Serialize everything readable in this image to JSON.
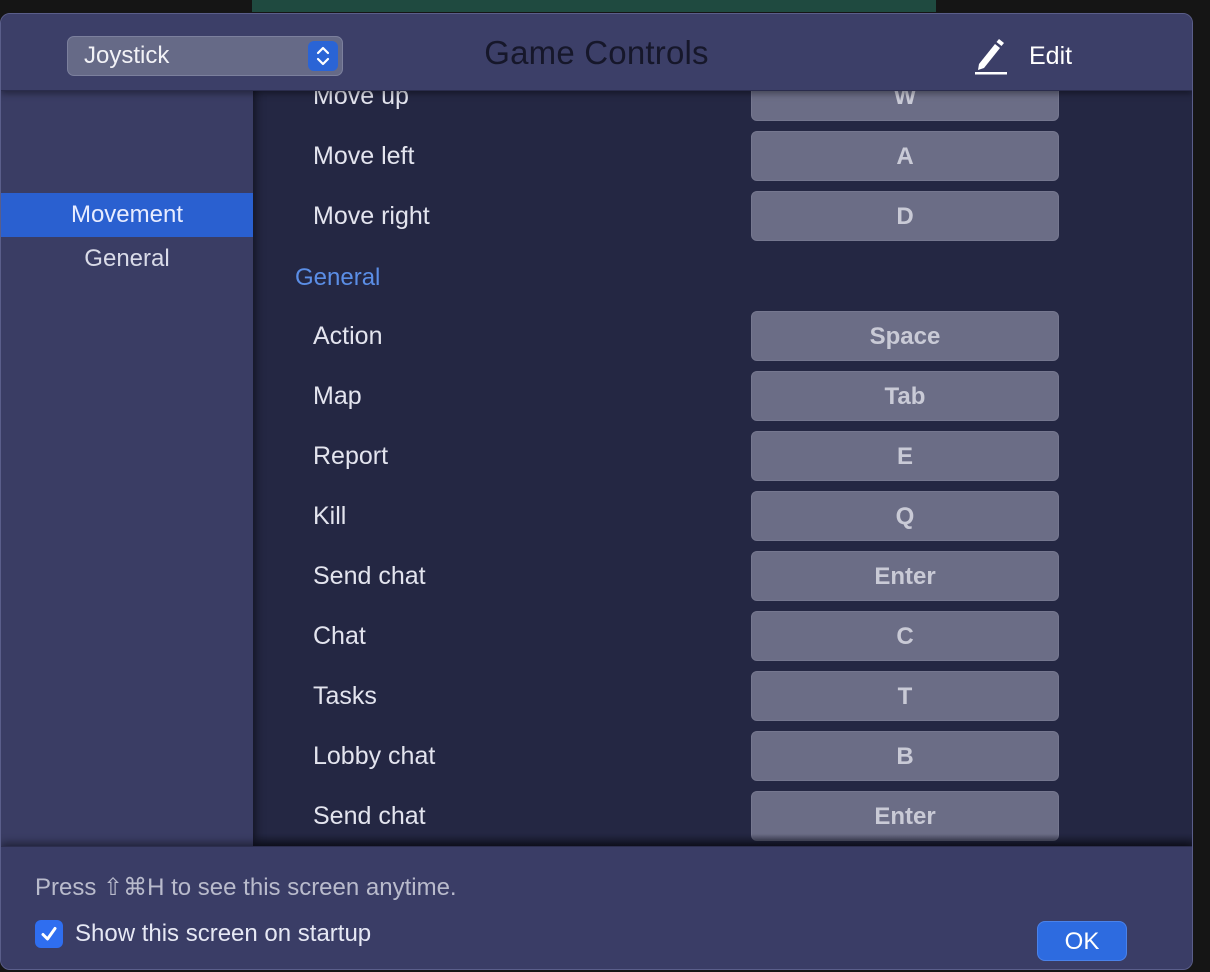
{
  "window": {
    "title": "Game Controls",
    "mode_select": {
      "value": "Joystick",
      "icon": "up-down-chevron-icon"
    },
    "edit": {
      "label": "Edit",
      "icon": "pencil-icon"
    }
  },
  "sidebar": {
    "items": [
      {
        "label": "Movement",
        "active": true
      },
      {
        "label": "General",
        "active": false
      }
    ]
  },
  "controls": {
    "movement_rows": [
      {
        "action": "Move up",
        "key": "W"
      },
      {
        "action": "Move left",
        "key": "A"
      },
      {
        "action": "Move right",
        "key": "D"
      }
    ],
    "general_header": "General",
    "general_rows": [
      {
        "action": "Action",
        "key": "Space"
      },
      {
        "action": "Map",
        "key": "Tab"
      },
      {
        "action": "Report",
        "key": "E"
      },
      {
        "action": "Kill",
        "key": "Q"
      },
      {
        "action": "Send chat",
        "key": "Enter"
      },
      {
        "action": "Chat",
        "key": "C"
      },
      {
        "action": "Tasks",
        "key": "T"
      },
      {
        "action": "Lobby chat",
        "key": "B"
      },
      {
        "action": "Send chat",
        "key": "Enter"
      }
    ]
  },
  "footer": {
    "hint": "Press ⇧⌘H to see this screen anytime.",
    "show_on_startup": {
      "label": "Show this screen on startup",
      "checked": true
    },
    "ok_label": "OK"
  },
  "colors": {
    "accent": "#2a60d0",
    "section_header": "#5b8ee6",
    "key_button": "#6b6d86",
    "content_bg": "#242743",
    "panel_bg": "#3a3d66"
  }
}
